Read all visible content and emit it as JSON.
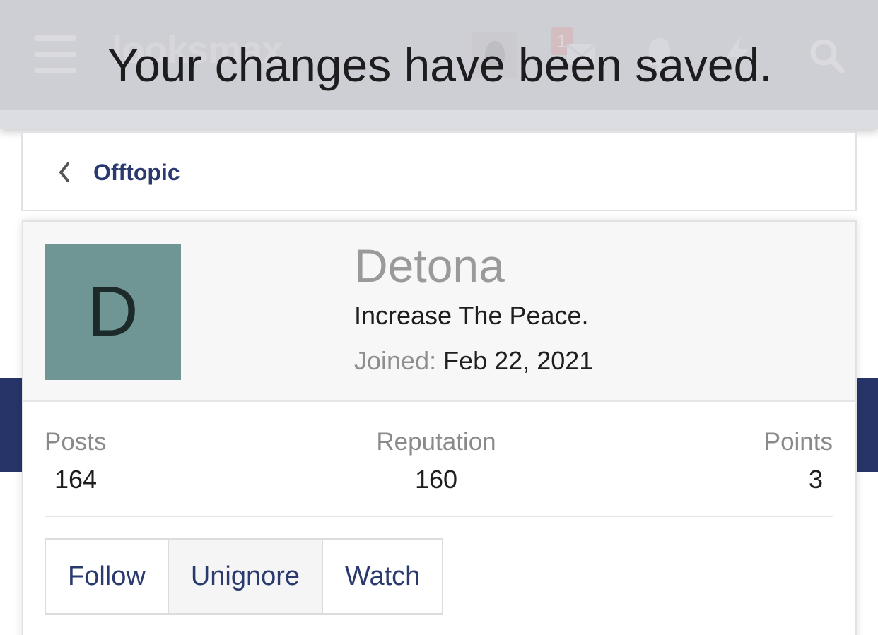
{
  "header": {
    "logo_text": "looksmax",
    "notification_count": "1"
  },
  "notice": {
    "message": "Your changes have been saved."
  },
  "breadcrumb": {
    "label": "Offtopic"
  },
  "profile": {
    "avatar_letter": "D",
    "avatar_color": "#6f9595",
    "username": "Detona",
    "user_title": "Increase The Peace.",
    "joined_label": "Joined:",
    "joined_value": "Feb 22, 2021"
  },
  "stats": {
    "posts": {
      "label": "Posts",
      "value": "164"
    },
    "reputation": {
      "label": "Reputation",
      "value": "160"
    },
    "points": {
      "label": "Points",
      "value": "3"
    }
  },
  "actions": {
    "follow": "Follow",
    "unignore": "Unignore",
    "watch": "Watch"
  },
  "colors": {
    "accent": "#2b3a6e",
    "band": "#273468"
  }
}
